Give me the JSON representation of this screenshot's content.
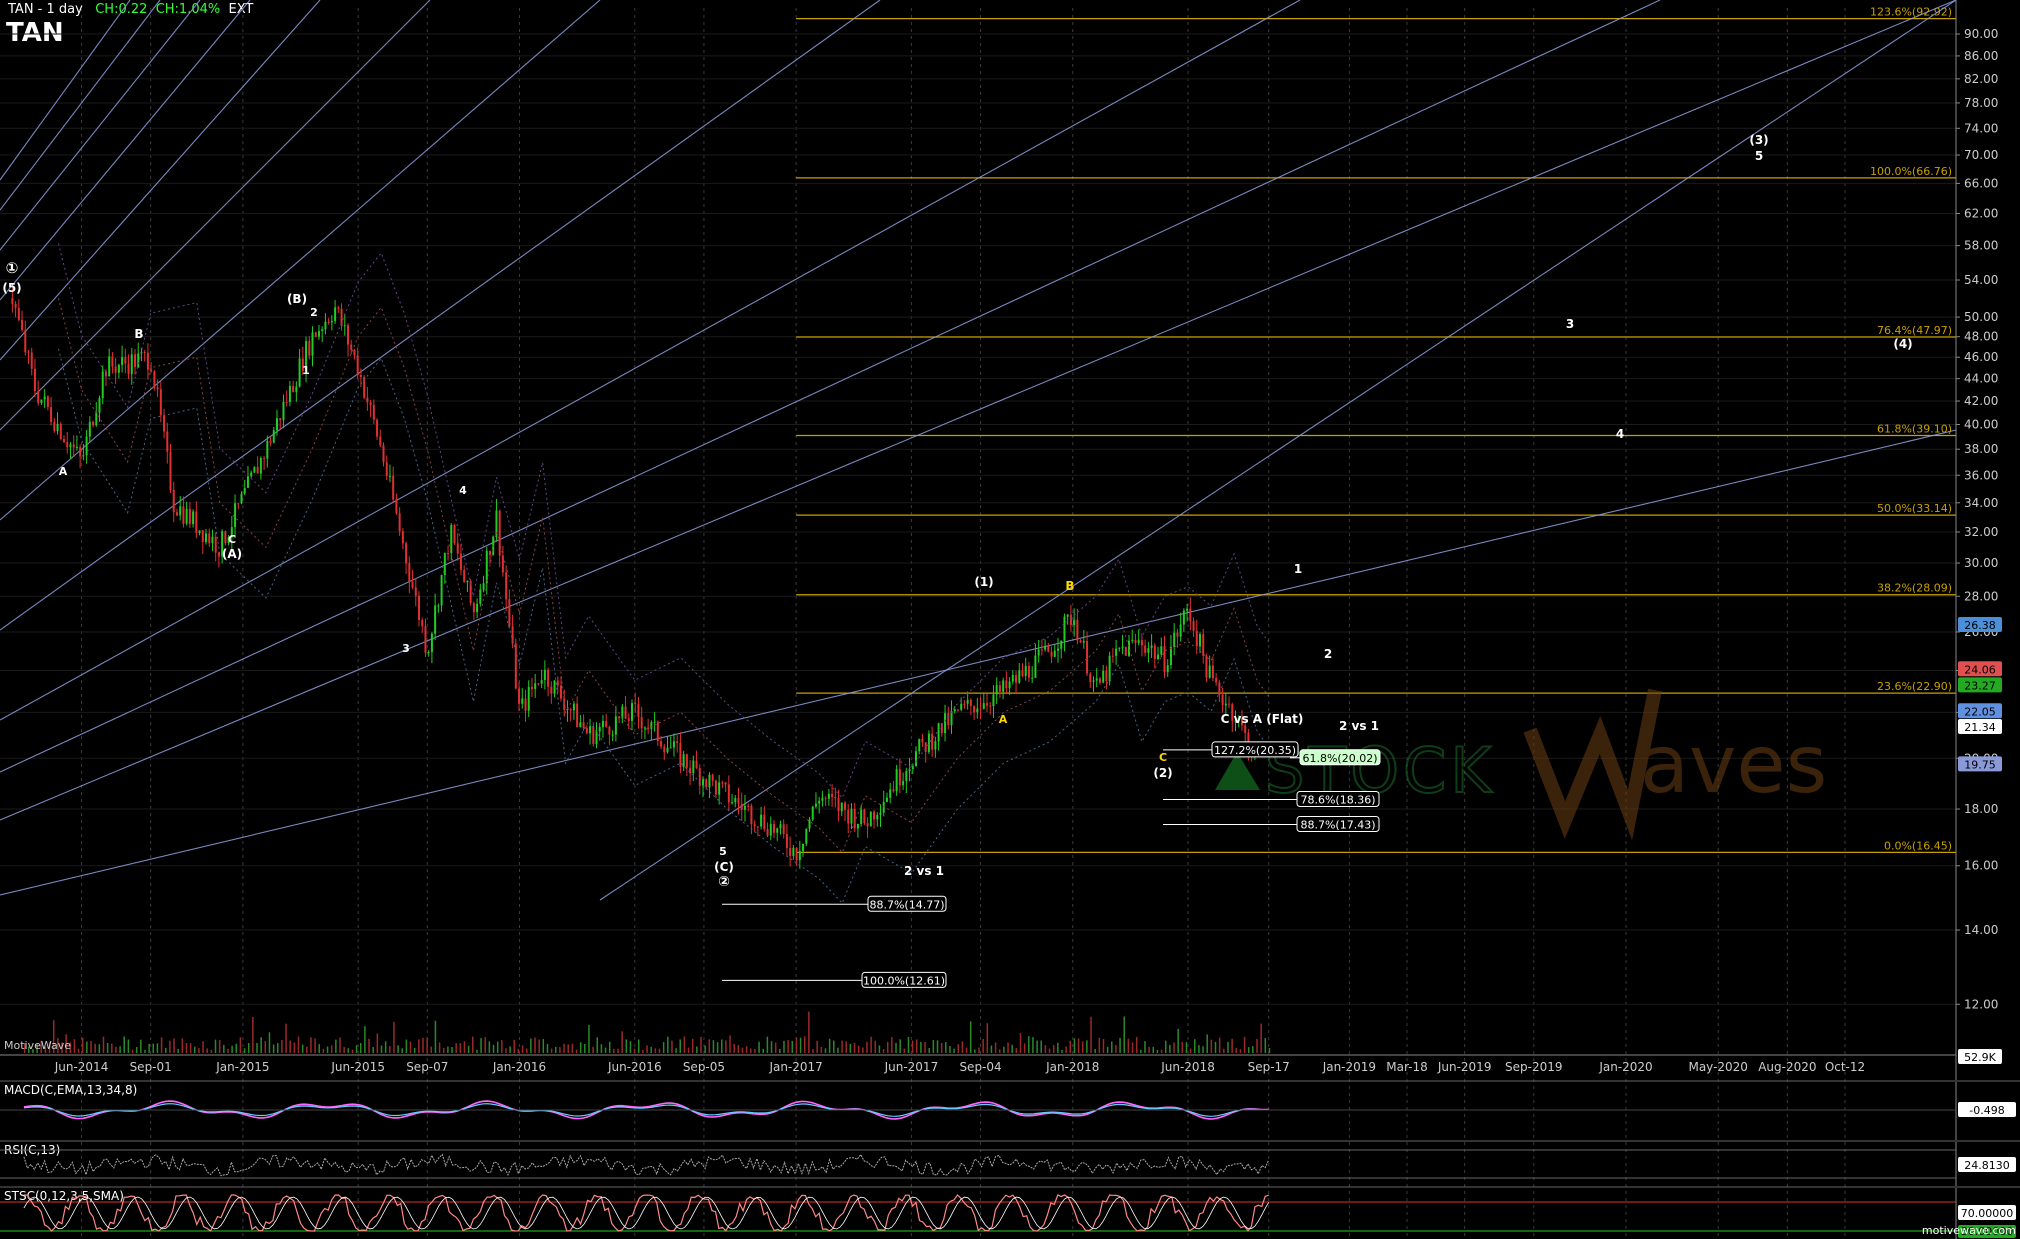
{
  "header": {
    "title": "TAN - 1 day",
    "ch": "CH:0.22",
    "chp": "CH:1.04%",
    "ext": "EXT",
    "symbol": "TAN"
  },
  "footer": {
    "site": "motivewave.com",
    "motivewave_label": "MotiveWave"
  },
  "watermark": {
    "text_left": "STOCK",
    "text_right": "aves"
  },
  "colors": {
    "fib": "#c8a000",
    "fan": "#8fa0e0",
    "up": "#22cc22",
    "down": "#e03030",
    "label": "#ffffff",
    "yellow_label": "#ffd700"
  },
  "chart_data": [
    {
      "type": "line",
      "name": "TAN price",
      "yscale": "log",
      "ylim": [
        10.8,
        95
      ],
      "x_ticks": [
        "Jun-2014",
        "Sep-01",
        "Jan-2015",
        "Jun-2015",
        "Sep-07",
        "Jan-2016",
        "Jun-2016",
        "Sep-05",
        "Jan-2017",
        "Jun-2017",
        "Sep-04",
        "Jan-2018",
        "Jun-2018",
        "Sep-17",
        "Jan-2019",
        "Mar-18",
        "Jun-2019",
        "Sep-2019",
        "Jan-2020",
        "May-2020",
        "Aug-2020",
        "Oct-12"
      ],
      "y_ticks": [
        12.0,
        14.0,
        16.0,
        18.0,
        20.0,
        22.0,
        24.0,
        26.0,
        28.0,
        30.0,
        32.0,
        34.0,
        36.0,
        38.0,
        40.0,
        42.0,
        44.0,
        46.0,
        48.0,
        50.0,
        54.0,
        58.0,
        62.0,
        66.0,
        70.0,
        74.0,
        78.0,
        82.0,
        86.0,
        90.0
      ],
      "price_points": [
        [
          "Mar-2014",
          52
        ],
        [
          "Apr-2014",
          43
        ],
        [
          "Jun-2014",
          37
        ],
        [
          "Jul-2014",
          45
        ],
        [
          "Sep-2014",
          46
        ],
        [
          "Oct-2014",
          34
        ],
        [
          "Dec-2014",
          31
        ],
        [
          "Feb-2015",
          38
        ],
        [
          "Apr-2015",
          48
        ],
        [
          "May-2015",
          51
        ],
        [
          "Jun-2015",
          45
        ],
        [
          "Jul-2015",
          38
        ],
        [
          "Sep-2015",
          25
        ],
        [
          "Oct-2015",
          32
        ],
        [
          "Nov-2015",
          27
        ],
        [
          "Dec-2015",
          33
        ],
        [
          "Jan-2016",
          22
        ],
        [
          "Feb-2016",
          24
        ],
        [
          "Apr-2016",
          21
        ],
        [
          "Jun-2016",
          22
        ],
        [
          "Aug-2016",
          20
        ],
        [
          "Oct-2016",
          18.5
        ],
        [
          "Dec-2016",
          17.3
        ],
        [
          "Jan-2017",
          16.45
        ],
        [
          "Feb-2017",
          18.5
        ],
        [
          "Apr-2017",
          17.5
        ],
        [
          "Jun-2017",
          20
        ],
        [
          "Aug-2017",
          22
        ],
        [
          "Oct-2017",
          23
        ],
        [
          "Dec-2017",
          25
        ],
        [
          "Jan-2018",
          27
        ],
        [
          "Feb-2018",
          23
        ],
        [
          "Mar-2018",
          25
        ],
        [
          "Apr-2018",
          25.5
        ],
        [
          "May-2018",
          24.5
        ],
        [
          "Jun-2018",
          27.3
        ],
        [
          "Jul-2018",
          23.5
        ],
        [
          "Aug-2018",
          22
        ],
        [
          "Sep-2018",
          19.8
        ]
      ],
      "price_labels": [
        {
          "label": "26.38",
          "value": 26.38,
          "color": "#4a8fd8"
        },
        {
          "label": "24.06",
          "value": 24.06,
          "color": "#e05050"
        },
        {
          "label": "23.27",
          "value": 23.27,
          "color": "#22aa22"
        },
        {
          "label": "22.05",
          "value": 22.05,
          "color": "#6090e0"
        },
        {
          "label": "21.34",
          "value": 21.34,
          "color": "#000000"
        },
        {
          "label": "19.75",
          "value": 19.75,
          "color": "#8a9ad8"
        },
        {
          "label": "52.9K",
          "value": 0,
          "color": "#000000"
        }
      ],
      "fib_levels": [
        {
          "label": "123.6%(92.92)",
          "value": 92.92
        },
        {
          "label": "100.0%(66.76)",
          "value": 66.76
        },
        {
          "label": "76.4%(47.97)",
          "value": 47.97
        },
        {
          "label": "61.8%(39.10)",
          "value": 39.1
        },
        {
          "label": "50.0%(33.14)",
          "value": 33.14
        },
        {
          "label": "38.2%(28.09)",
          "value": 28.09
        },
        {
          "label": "23.6%(22.90)",
          "value": 22.9
        },
        {
          "label": "0.0%(16.45)",
          "value": 16.45
        }
      ],
      "wave_targets": [
        {
          "label": "127.2%(20.35)",
          "value": 20.35
        },
        {
          "label": "61.8%(20.02)",
          "value": 20.02,
          "highlight": true
        },
        {
          "label": "78.6%(18.36)",
          "value": 18.36
        },
        {
          "label": "88.7%(17.43)",
          "value": 17.43
        },
        {
          "label": "88.7%(14.77)",
          "value": 14.77
        },
        {
          "label": "100.0%(12.61)",
          "value": 12.61
        }
      ],
      "annotations": [
        {
          "text": "C vs A (Flat)"
        },
        {
          "text": "2 vs 1"
        },
        {
          "text": "2 vs 1"
        },
        {
          "text": "①"
        },
        {
          "text": "(5)"
        },
        {
          "text": "B"
        },
        {
          "text": "A"
        },
        {
          "text": "(B)"
        },
        {
          "text": "2"
        },
        {
          "text": "1"
        },
        {
          "text": "C"
        },
        {
          "text": "(A)"
        },
        {
          "text": "4"
        },
        {
          "text": "3"
        },
        {
          "text": "5"
        },
        {
          "text": "(C)"
        },
        {
          "text": "②"
        },
        {
          "text": "(1)"
        },
        {
          "text": "B"
        },
        {
          "text": "A"
        },
        {
          "text": "C"
        },
        {
          "text": "(2)"
        },
        {
          "text": "1"
        },
        {
          "text": "2"
        },
        {
          "text": "3"
        },
        {
          "text": "4"
        },
        {
          "text": "(3)"
        },
        {
          "text": "5"
        },
        {
          "text": "(4)"
        }
      ]
    },
    {
      "type": "line",
      "name": "MACD",
      "title": "MACD(C,EMA,13,34,8)",
      "value_label": "-0.498"
    },
    {
      "type": "line",
      "name": "RSI",
      "title": "RSI(C,13)",
      "value_label": "24.8130"
    },
    {
      "type": "line",
      "name": "STSC",
      "title": "STSC(0,12,3,5,SMA)",
      "value_label": "70.00000",
      "value_label_2": "30.00000"
    }
  ]
}
